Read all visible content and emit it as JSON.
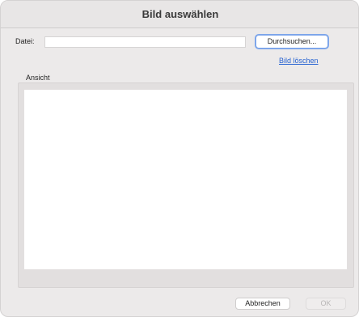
{
  "dialog": {
    "title": "Bild auswählen"
  },
  "file": {
    "label": "Datei:",
    "value": "",
    "placeholder": "",
    "browse_label": "Durchsuchen...",
    "delete_link": "Bild löschen"
  },
  "preview": {
    "label": "Ansicht"
  },
  "footer": {
    "cancel_label": "Abbrechen",
    "ok_label": "OK",
    "ok_enabled": false
  },
  "colors": {
    "focus_ring": "#7ea6ea",
    "link": "#2763d1",
    "window_bg": "#eceaea",
    "panel_bg": "#e2dfdf"
  }
}
